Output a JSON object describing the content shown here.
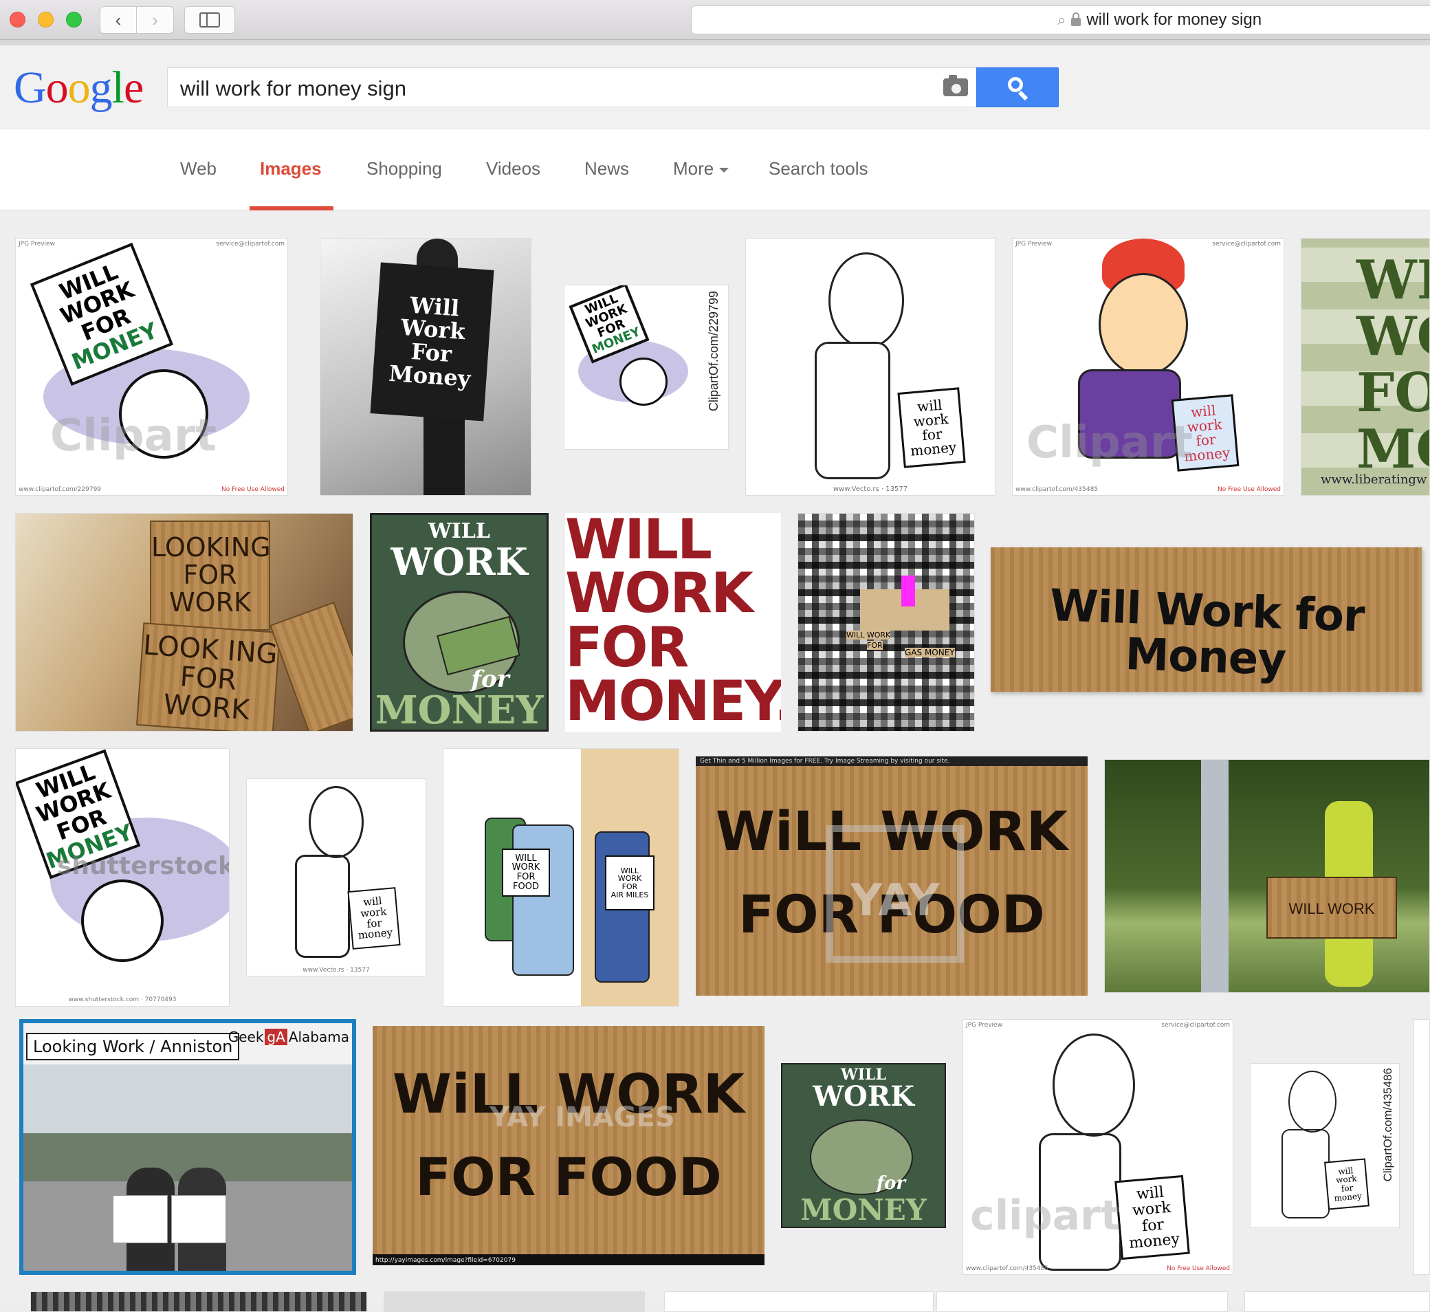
{
  "browser": {
    "address_text": "will work for money sign"
  },
  "google": {
    "logo_letters": [
      "G",
      "o",
      "o",
      "g",
      "l",
      "e"
    ],
    "query": "will work for money sign",
    "tabs": [
      {
        "label": "Web"
      },
      {
        "label": "Images"
      },
      {
        "label": "Shopping"
      },
      {
        "label": "Videos"
      },
      {
        "label": "News"
      },
      {
        "label": "More"
      },
      {
        "label": "Search tools"
      }
    ]
  },
  "thumbs": {
    "t1": {
      "sign_lines": [
        "WILL",
        "WORK",
        "FOR",
        "MONEY"
      ],
      "header_left": "JPG Preview",
      "header_right": "service@clipartof.com",
      "footer_left": "www.clipartof.com/229799",
      "footer_right": "No Free Use Allowed",
      "watermark": "Clipart"
    },
    "t2": {
      "sign_lines": [
        "Will",
        "Work",
        "For",
        "Money"
      ]
    },
    "t3": {
      "sign_lines": [
        "WILL",
        "WORK",
        "FOR",
        "MONEY"
      ],
      "vertical_text": "ClipartOf.com/229799"
    },
    "t4": {
      "sign_lines": [
        "will",
        "work",
        "for",
        "money"
      ],
      "footer": "www.Vecto.rs · 13577"
    },
    "t5": {
      "sign_lines": [
        "will",
        "work",
        "for",
        "money"
      ],
      "header_left": "JPG Preview",
      "header_right": "service@clipartof.com",
      "footer_left": "www.clipartof.com/435485",
      "footer_right": "No Free Use Allowed",
      "watermark": "Clipart"
    },
    "t6": {
      "lines": [
        "WI",
        "WO",
        "FO",
        "MO"
      ],
      "footer": "www.liberatingw"
    },
    "t7": {
      "top_sign": [
        "LOOKING",
        "FOR",
        "WORK"
      ],
      "mid_sign": [
        "LOOK ING",
        "FOR",
        "WORK"
      ]
    },
    "t8": {
      "top": "WILL",
      "mid": "WORK",
      "for_word": "for",
      "bottom": "MONEY"
    },
    "t9": {
      "lines": [
        "WILL",
        "WORK",
        "FOR",
        "MONEY."
      ]
    },
    "t10": {
      "text1": "WILL WORK",
      "text2": "FOR",
      "text3": "GAS MONEY"
    },
    "t11": {
      "text": "Will Work for Money"
    },
    "t12": {
      "sign_lines": [
        "WILL",
        "WORK",
        "FOR",
        "MONEY"
      ],
      "watermark": "shutterstock",
      "footer": "www.shutterstock.com · 70770493"
    },
    "t13": {
      "sign_lines": [
        "will",
        "work",
        "for",
        "money"
      ],
      "footer": "www.Vecto.rs · 13577"
    },
    "t14": {
      "sign_left": [
        "WILL",
        "WORK",
        "FOR",
        "FOOD"
      ],
      "sign_right": [
        "WILL",
        "WORK",
        "FOR",
        "AIR MILES"
      ]
    },
    "t15": {
      "header": "Get Thin and 5 Million Images for FREE. Try Image Streaming by visiting our site.",
      "line1": "WiLL WORK",
      "line2": "FOR FOOD",
      "watermark": "YAY"
    },
    "t16": {
      "sign_text": "WILL WORK"
    },
    "t17": {
      "title": "Looking Work / Anniston",
      "brand_left": "Geek",
      "brand_mid": "gA",
      "brand_right": "Alabama"
    },
    "t18": {
      "line1": "WiLL WORK",
      "line2": "FOR FOOD",
      "footer": "http://yayimages.com/image?fileid=6702079",
      "watermark": "YAY IMAGES"
    },
    "t19": {
      "top": "WILL",
      "mid": "WORK",
      "for_word": "for",
      "bottom": "MONEY"
    },
    "t20": {
      "sign_lines": [
        "will",
        "work",
        "for",
        "money"
      ],
      "header_left": "JPG Preview",
      "header_right": "service@clipartof.com",
      "footer_left": "www.clipartof.com/435485",
      "footer_right": "No Free Use Allowed",
      "watermark": "clipart"
    },
    "t21": {
      "sign_lines": [
        "will",
        "work",
        "for",
        "money"
      ],
      "vertical_text": "ClipartOf.com/435486"
    }
  }
}
